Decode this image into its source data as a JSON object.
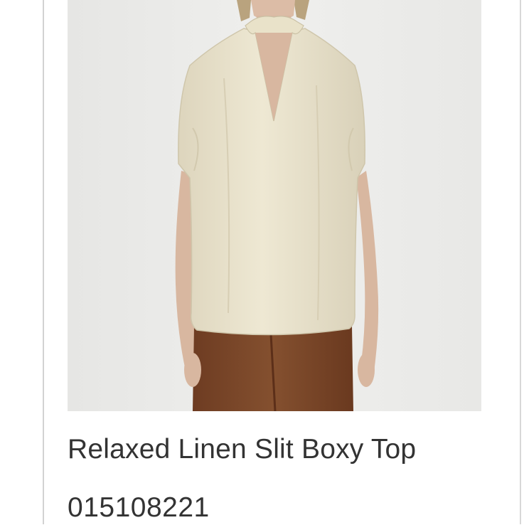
{
  "product": {
    "title": "Relaxed Linen Slit Boxy Top",
    "code": "015108221",
    "image_icon": "product-photo",
    "colors": {
      "background": "#ebebe9",
      "top": "#eae3cc",
      "pants": "#7a4528",
      "skin": "#d8b7a0"
    }
  }
}
